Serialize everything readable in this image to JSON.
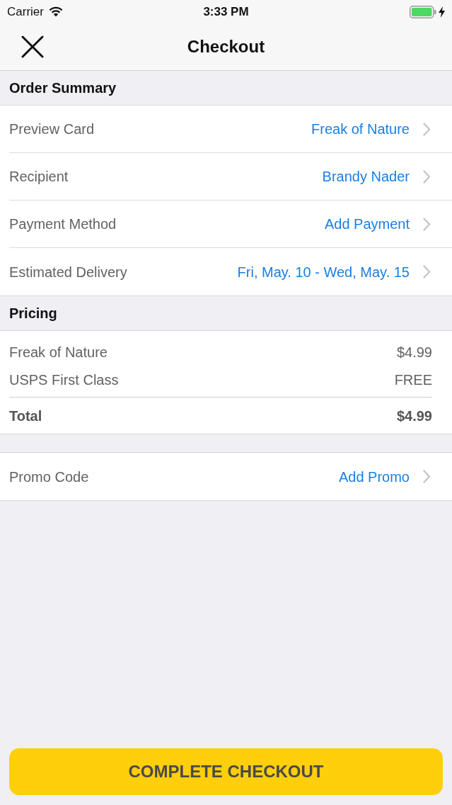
{
  "status_bar": {
    "carrier": "Carrier",
    "time": "3:33 PM"
  },
  "nav": {
    "title": "Checkout"
  },
  "order_summary": {
    "header": "Order Summary",
    "rows": [
      {
        "label": "Preview Card",
        "value": "Freak of Nature"
      },
      {
        "label": "Recipient",
        "value": "Brandy Nader"
      },
      {
        "label": "Payment Method",
        "value": "Add Payment"
      },
      {
        "label": "Estimated Delivery",
        "value": "Fri, May. 10 - Wed, May. 15"
      }
    ]
  },
  "pricing": {
    "header": "Pricing",
    "items": [
      {
        "label": "Freak of Nature",
        "amount": "$4.99"
      },
      {
        "label": "USPS First Class",
        "amount": "FREE"
      }
    ],
    "total": {
      "label": "Total",
      "amount": "$4.99"
    }
  },
  "promo": {
    "label": "Promo Code",
    "value": "Add Promo"
  },
  "checkout_button": {
    "label": "COMPLETE CHECKOUT"
  }
}
